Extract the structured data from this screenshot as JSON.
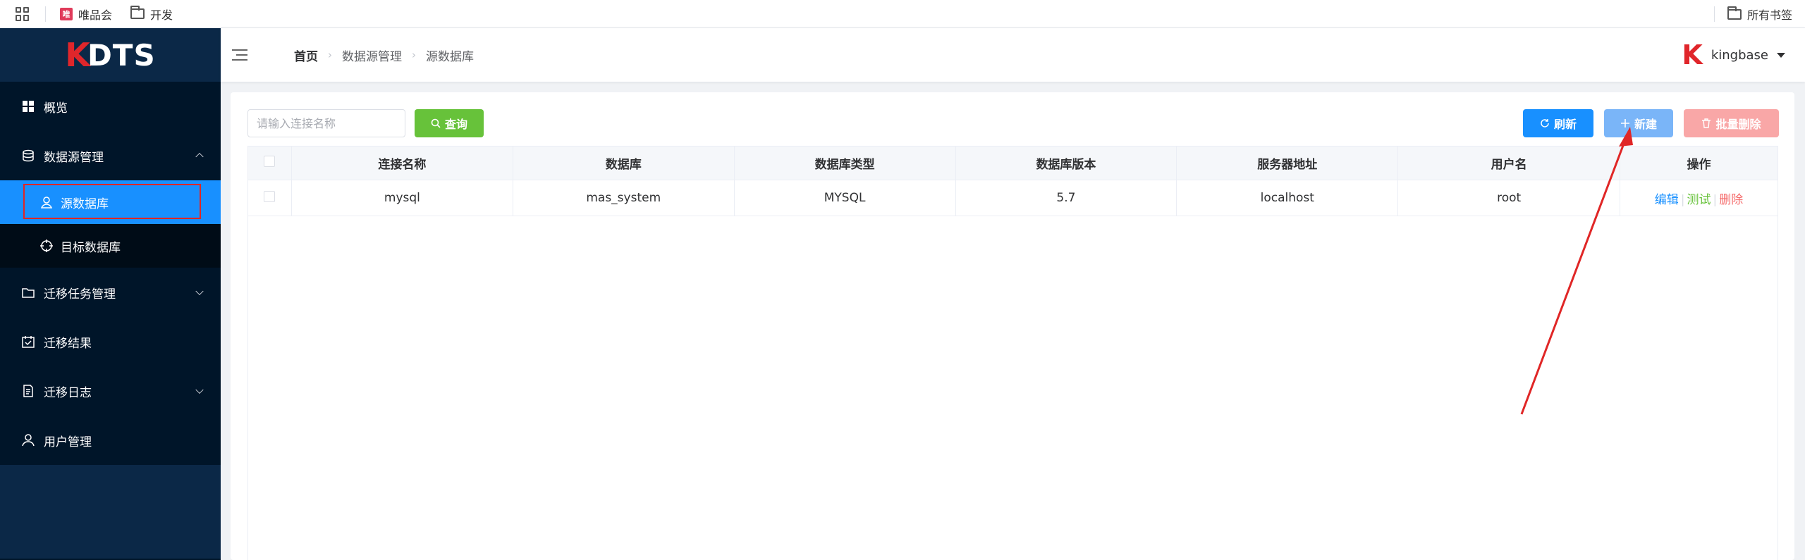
{
  "bookmarks": {
    "items": [
      {
        "label": "唯品会",
        "icon": "vip-icon"
      },
      {
        "label": "开发",
        "icon": "folder-icon"
      }
    ],
    "all_bookmarks": "所有书签"
  },
  "sidebar": {
    "logo": {
      "k": "K",
      "text": "DTS"
    },
    "items": [
      {
        "label": "概览",
        "icon": "dashboard-icon"
      },
      {
        "label": "数据源管理",
        "icon": "database-icon",
        "expanded": true
      },
      {
        "label": "迁移任务管理",
        "icon": "folder-icon",
        "expanded": false
      },
      {
        "label": "迁移结果",
        "icon": "calendar-check-icon"
      },
      {
        "label": "迁移日志",
        "icon": "document-icon",
        "expanded": false
      },
      {
        "label": "用户管理",
        "icon": "user-icon"
      }
    ],
    "subitems": [
      {
        "label": "源数据库",
        "icon": "user-pin-icon",
        "active": true
      },
      {
        "label": "目标数据库",
        "icon": "target-icon"
      }
    ]
  },
  "header": {
    "breadcrumb": [
      "首页",
      "数据源管理",
      "源数据库"
    ],
    "user": "kingbase"
  },
  "toolbar": {
    "search_placeholder": "请输入连接名称",
    "query_label": "查询",
    "refresh_label": "刷新",
    "new_label": "新建",
    "batch_delete_label": "批量删除"
  },
  "table": {
    "columns": [
      "连接名称",
      "数据库",
      "数据库类型",
      "数据库版本",
      "服务器地址",
      "用户名",
      "操作"
    ],
    "rows": [
      {
        "name": "mysql",
        "database": "mas_system",
        "type": "MYSQL",
        "version": "5.7",
        "host": "localhost",
        "user": "root"
      }
    ],
    "actions": {
      "edit": "编辑",
      "test": "测试",
      "delete": "删除"
    }
  },
  "colors": {
    "sidebar_bg": "#001529",
    "active": "#1890ff",
    "success": "#67c23a",
    "danger": "#f56c6c",
    "annotation": "#e02626"
  }
}
